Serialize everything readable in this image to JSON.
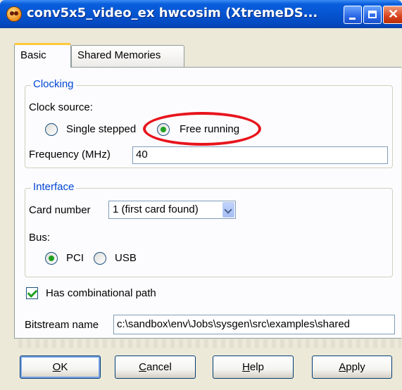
{
  "window": {
    "title": "conv5x5_video_ex hwcosim (XtremeDS...",
    "icon": "app-face-icon"
  },
  "tabs": [
    {
      "label": "Basic",
      "active": true
    },
    {
      "label": "Shared Memories",
      "active": false
    }
  ],
  "clocking": {
    "legend": "Clocking",
    "clock_source_label": "Clock source:",
    "options": [
      {
        "label": "Single stepped",
        "checked": false
      },
      {
        "label": "Free running",
        "checked": true
      }
    ],
    "frequency_label": "Frequency (MHz)",
    "frequency_value": "40",
    "highlight_color": "#e8141c"
  },
  "interface": {
    "legend": "Interface",
    "card_number_label": "Card number",
    "card_number_value": "1 (first card found)",
    "bus_label": "Bus:",
    "bus_options": [
      {
        "label": "PCI",
        "checked": true
      },
      {
        "label": "USB",
        "checked": false
      }
    ]
  },
  "has_combinational_path": {
    "label": "Has combinational path",
    "checked": true
  },
  "bitstream": {
    "label": "Bitstream name",
    "value": "c:\\sandbox\\env\\Jobs\\sysgen\\src\\examples\\shared"
  },
  "buttons": {
    "ok": {
      "mnemonic": "O",
      "rest": "K"
    },
    "cancel": {
      "mnemonic": "C",
      "rest": "ancel"
    },
    "help": {
      "mnemonic": "H",
      "rest": "elp"
    },
    "apply": {
      "mnemonic": "A",
      "rest": "pply"
    }
  },
  "colors": {
    "titlebar": "#0554d0",
    "legend_text": "#0046d5",
    "dialog_bg": "#ece9d8"
  }
}
